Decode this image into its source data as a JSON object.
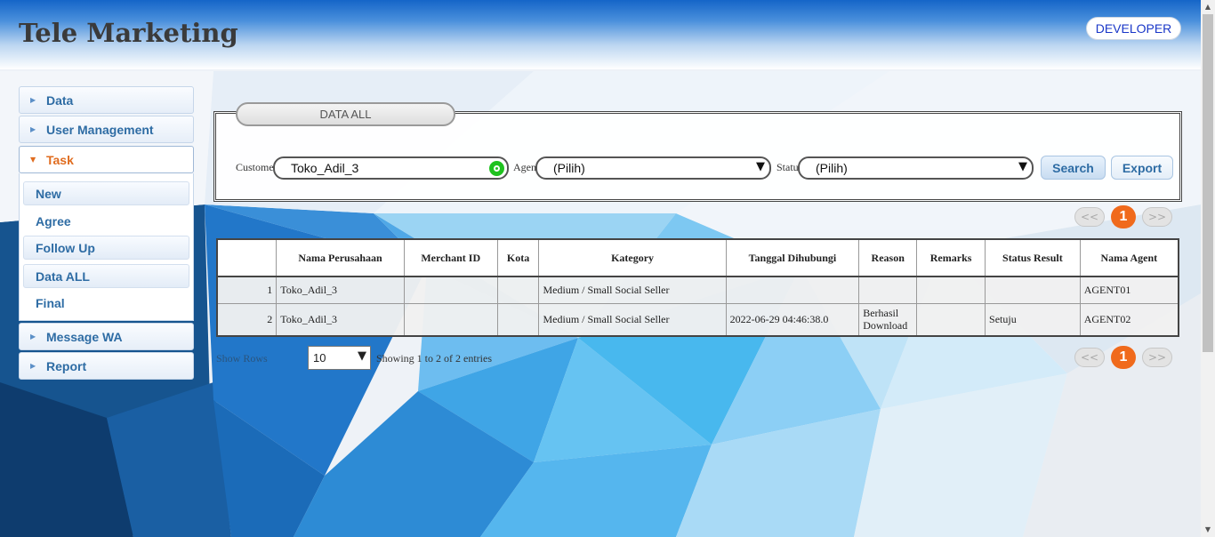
{
  "header": {
    "title": "Tele Marketing",
    "developer_label": "DEVELOPER"
  },
  "sidebar": {
    "items": [
      {
        "label": "Data"
      },
      {
        "label": "User Management"
      },
      {
        "label": "Task"
      },
      {
        "label": "Message WA"
      },
      {
        "label": "Report"
      }
    ],
    "task_submenu": [
      {
        "label": "New"
      },
      {
        "label": "Agree"
      },
      {
        "label": "Follow Up"
      },
      {
        "label": "Data ALL"
      },
      {
        "label": "Final"
      }
    ]
  },
  "filter": {
    "title": "DATA ALL",
    "customer_label": "Customer",
    "customer_value": "Toko_Adil_3",
    "agent_label": "Agent",
    "agent_value": "(Pilih)",
    "status_label": "Status",
    "status_value": "(Pilih)",
    "search_label": "Search",
    "export_label": "Export"
  },
  "pagination": {
    "prev": "<<",
    "current": "1",
    "next": ">>"
  },
  "table": {
    "headers": [
      "",
      "Nama Perusahaan",
      "Merchant ID",
      "Kota",
      "Kategory",
      "Tanggal Dihubungi",
      "Reason",
      "Remarks",
      "Status Result",
      "Nama Agent"
    ],
    "rows": [
      [
        "1",
        "Toko_Adil_3",
        "",
        "",
        "Medium / Small Social Seller",
        "",
        "",
        "",
        "",
        "AGENT01"
      ],
      [
        "2",
        "Toko_Adil_3",
        "",
        "",
        "Medium / Small Social Seller",
        "2022-06-29 04:46:38.0",
        "Berhasil Download",
        "",
        "Setuju",
        "AGENT02"
      ]
    ]
  },
  "footer": {
    "show_rows_label": "Show Rows",
    "rows_value": "10",
    "entries_info": "Showing 1 to 2 of 2 entries"
  },
  "colors": {
    "accent": "#f06a1c",
    "link": "#2e6ca4",
    "developer": "#1a37c8",
    "clear": "#1fc21f"
  },
  "icons": {
    "menu_arrow": "triangle-right-icon",
    "menu_arrow_open": "triangle-down-icon",
    "dropdown": "caret-down-icon",
    "clear": "clear-circle-icon"
  }
}
